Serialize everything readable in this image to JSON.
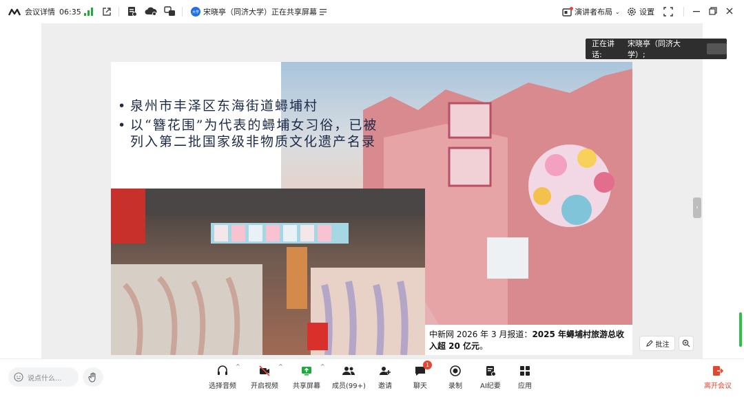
{
  "topbar": {
    "meeting_details": "会议详情",
    "time": "06:35",
    "sharer_badge": "大学",
    "sharer_text": "宋晓亭（同济大学）正在共享屏幕",
    "layout": "演讲者布局",
    "settings": "设置"
  },
  "speaking": {
    "label": "正在讲话:",
    "name": "宋晓亭（同济大学）;"
  },
  "slide": {
    "bullet_1": "泉州市丰泽区东海街道蟳埔村",
    "bullet_2": "以“簪花围”为代表的蟳埔女习俗，已被列入第二批国家级非物质文化遗产名录",
    "caption_pre": "中新网 2026 年 3 月报道：",
    "caption_bold": "2025 年蟳埔村旅游总收入超 20 亿元",
    "caption_post": "。"
  },
  "annotate": {
    "label": "批注"
  },
  "chat_input": {
    "placeholder": "说点什么..."
  },
  "toolbar": {
    "audio": "选择音频",
    "video": "开启视频",
    "share": "共享屏幕",
    "members": "成员(99+)",
    "invite": "邀请",
    "chat": "聊天",
    "chat_badge": "1",
    "record": "录制",
    "ai": "AI纪要",
    "apps": "应用",
    "leave": "离开会议"
  },
  "colors": {
    "accent": "#1f6fe5",
    "danger": "#e5462f",
    "signal": "#1fab3b"
  }
}
